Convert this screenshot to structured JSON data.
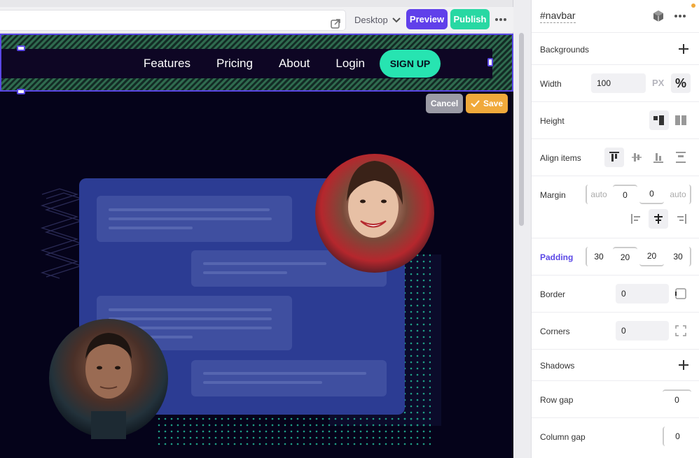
{
  "toolbar": {
    "device": "Desktop",
    "preview": "Preview",
    "publish": "Publish"
  },
  "nav": {
    "links": [
      "Features",
      "Pricing",
      "About",
      "Login"
    ],
    "cta": "SIGN UP"
  },
  "edit_actions": {
    "cancel": "Cancel",
    "save": "Save"
  },
  "panel": {
    "selector": "#navbar",
    "backgrounds": "Backgrounds",
    "width": {
      "label": "Width",
      "value": "100",
      "unit_px": "PX",
      "unit_pct": "%"
    },
    "height": {
      "label": "Height"
    },
    "align_items": {
      "label": "Align items"
    },
    "margin": {
      "label": "Margin",
      "values": [
        "auto",
        "0",
        "0",
        "auto"
      ]
    },
    "padding": {
      "label": "Padding",
      "values": [
        "30",
        "20",
        "20",
        "30"
      ]
    },
    "border": {
      "label": "Border",
      "value": "0"
    },
    "corners": {
      "label": "Corners",
      "value": "0"
    },
    "shadows": "Shadows",
    "row_gap": {
      "label": "Row gap",
      "value": "0"
    },
    "column_gap": {
      "label": "Column gap",
      "value": "0"
    }
  },
  "colors": {
    "accent": "#6040ea",
    "publish": "#28d8a3",
    "signup": "#27e4b1",
    "save": "#f0a93b",
    "canvas": "#05031a"
  }
}
